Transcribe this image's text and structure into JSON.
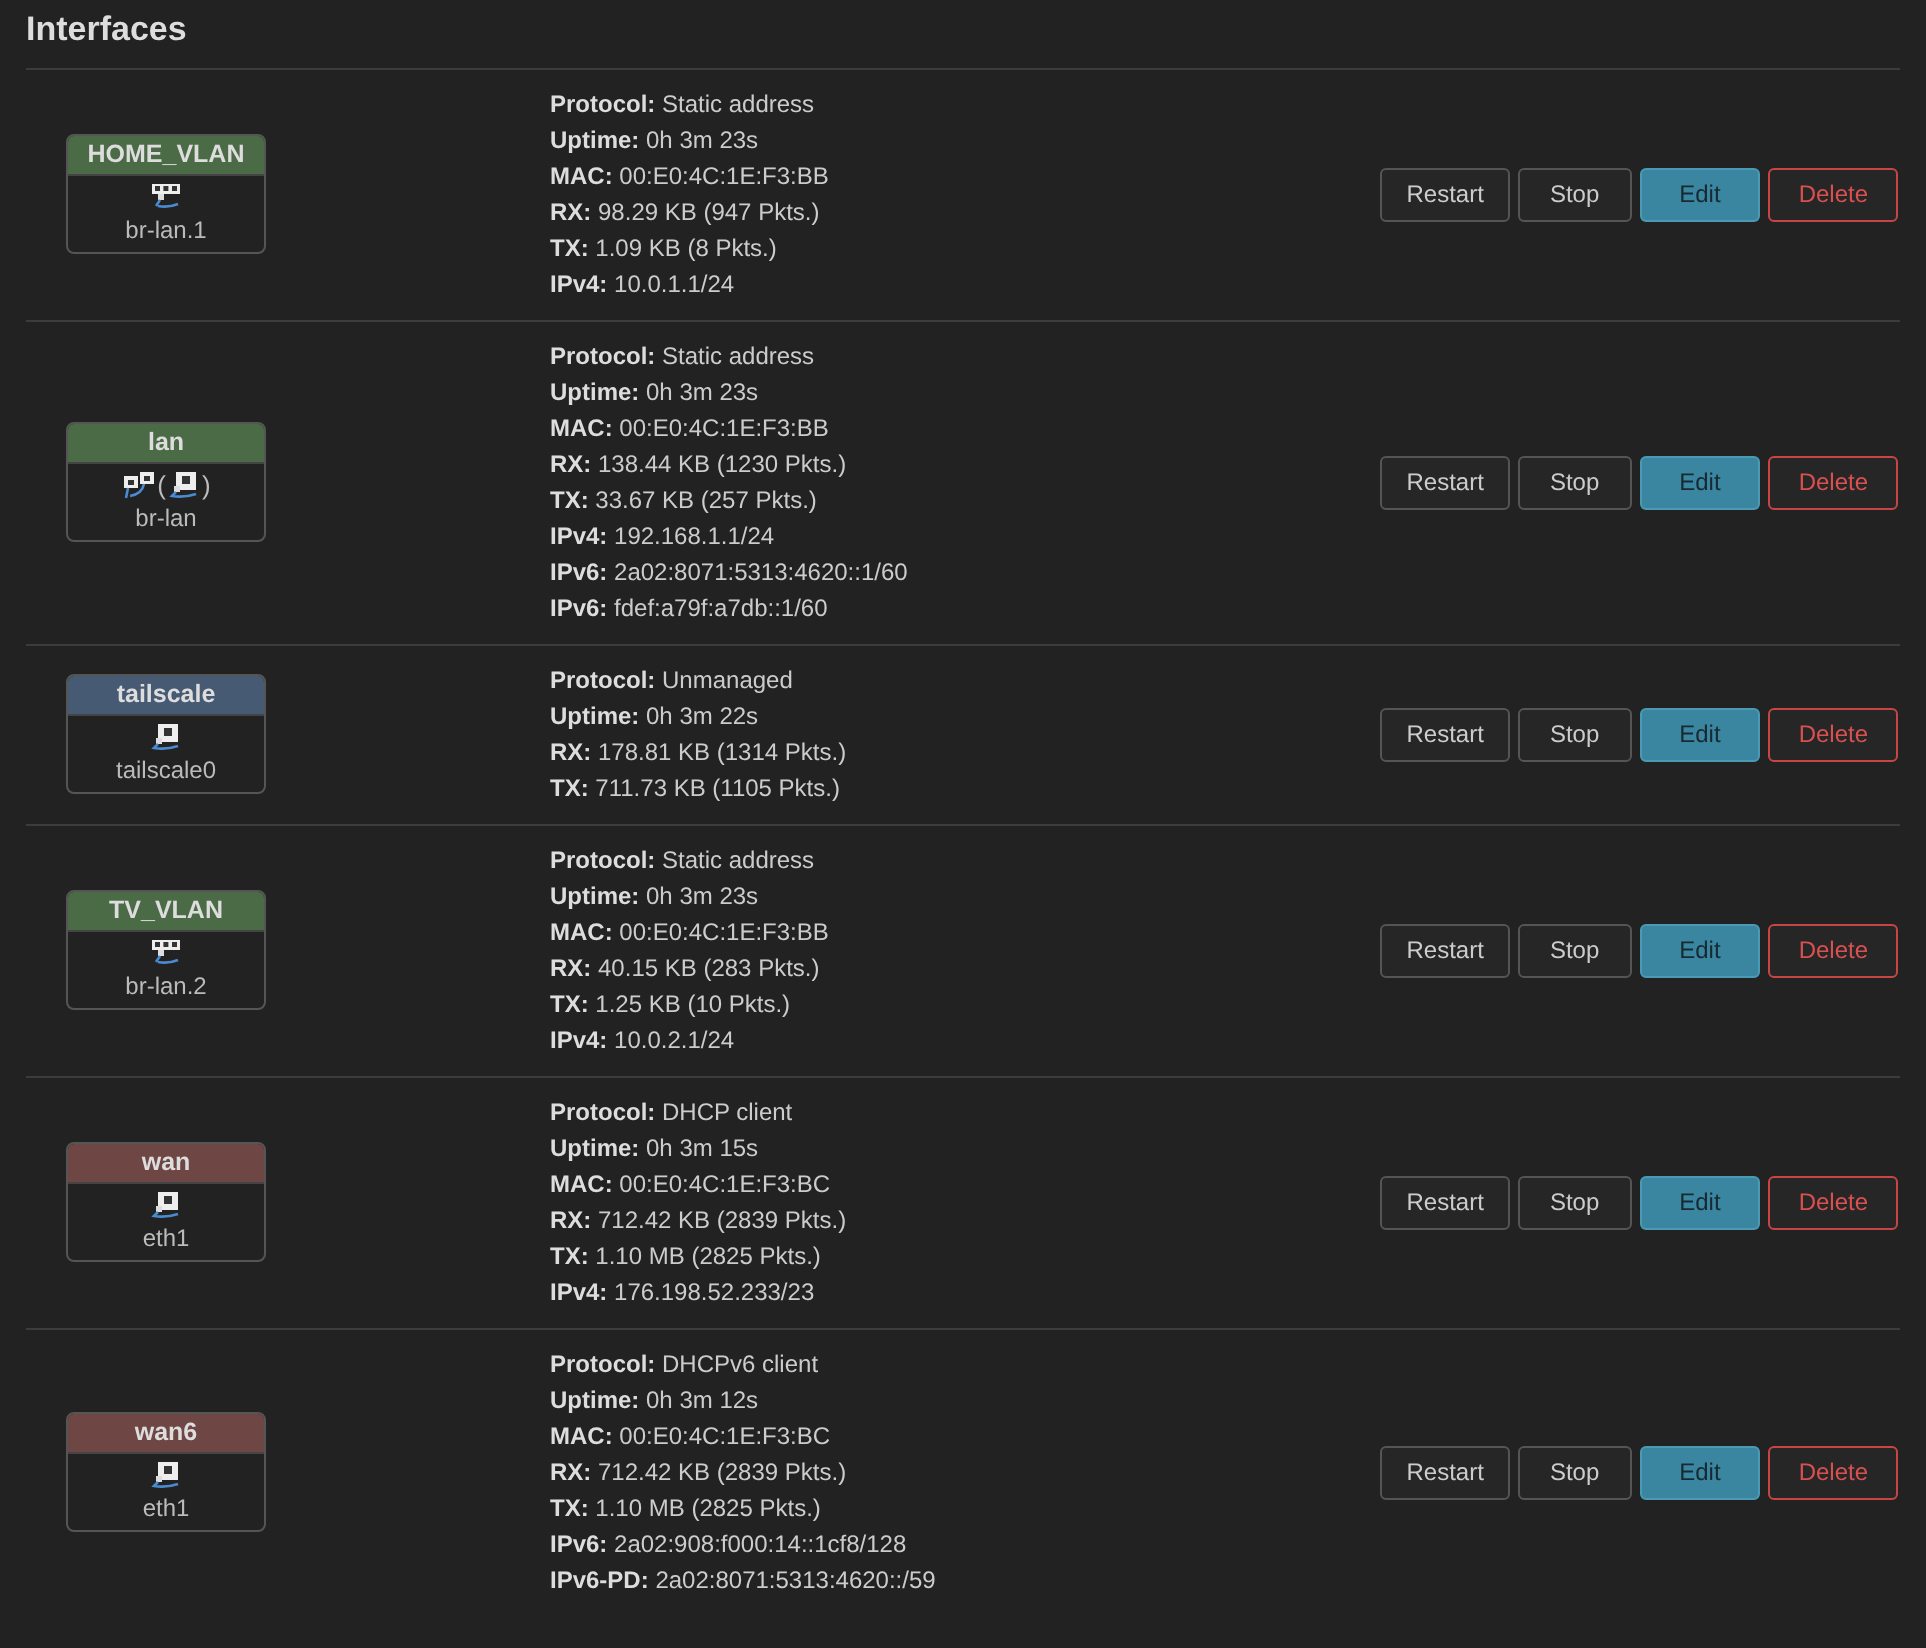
{
  "title": "Interfaces",
  "interfaces": [
    {
      "name": "HOME_VLAN",
      "color": "#4b6b47",
      "device_parts": [
        {
          "kind": "switch"
        }
      ],
      "device": "br-lan.1",
      "details": [
        {
          "label": "Protocol:",
          "value": "Static address"
        },
        {
          "label": "Uptime:",
          "value": "0h 3m 23s"
        },
        {
          "label": "MAC:",
          "value": "00:E0:4C:1E:F3:BB"
        },
        {
          "label": "RX:",
          "value": "98.29 KB (947 Pkts.)"
        },
        {
          "label": "TX:",
          "value": "1.09 KB (8 Pkts.)"
        },
        {
          "label": "IPv4:",
          "value": "10.0.1.1/24"
        }
      ],
      "buttons": [
        {
          "label": "Restart",
          "kind": "default"
        },
        {
          "label": "Stop",
          "kind": "default"
        },
        {
          "label": "Edit",
          "kind": "edit"
        },
        {
          "label": "Delete",
          "kind": "delete"
        }
      ]
    },
    {
      "name": "lan",
      "color": "#4b6b47",
      "device_parts": [
        {
          "kind": "bridge"
        },
        {
          "kind": "text",
          "text": "("
        },
        {
          "kind": "port"
        },
        {
          "kind": "text",
          "text": ")"
        }
      ],
      "device": "br-lan",
      "details": [
        {
          "label": "Protocol:",
          "value": "Static address"
        },
        {
          "label": "Uptime:",
          "value": "0h 3m 23s"
        },
        {
          "label": "MAC:",
          "value": "00:E0:4C:1E:F3:BB"
        },
        {
          "label": "RX:",
          "value": "138.44 KB (1230 Pkts.)"
        },
        {
          "label": "TX:",
          "value": "33.67 KB (257 Pkts.)"
        },
        {
          "label": "IPv4:",
          "value": "192.168.1.1/24"
        },
        {
          "label": "IPv6:",
          "value": "2a02:8071:5313:4620::1/60"
        },
        {
          "label": "IPv6:",
          "value": "fdef:a79f:a7db::1/60"
        }
      ],
      "buttons": [
        {
          "label": "Restart",
          "kind": "default"
        },
        {
          "label": "Stop",
          "kind": "default"
        },
        {
          "label": "Edit",
          "kind": "edit"
        },
        {
          "label": "Delete",
          "kind": "delete"
        }
      ]
    },
    {
      "name": "tailscale",
      "color": "#465a74",
      "device_parts": [
        {
          "kind": "port"
        }
      ],
      "device": "tailscale0",
      "details": [
        {
          "label": "Protocol:",
          "value": "Unmanaged"
        },
        {
          "label": "Uptime:",
          "value": "0h 3m 22s"
        },
        {
          "label": "RX:",
          "value": "178.81 KB (1314 Pkts.)"
        },
        {
          "label": "TX:",
          "value": "711.73 KB (1105 Pkts.)"
        }
      ],
      "buttons": [
        {
          "label": "Restart",
          "kind": "default"
        },
        {
          "label": "Stop",
          "kind": "default"
        },
        {
          "label": "Edit",
          "kind": "edit"
        },
        {
          "label": "Delete",
          "kind": "delete"
        }
      ]
    },
    {
      "name": "TV_VLAN",
      "color": "#4b6b47",
      "device_parts": [
        {
          "kind": "switch"
        }
      ],
      "device": "br-lan.2",
      "details": [
        {
          "label": "Protocol:",
          "value": "Static address"
        },
        {
          "label": "Uptime:",
          "value": "0h 3m 23s"
        },
        {
          "label": "MAC:",
          "value": "00:E0:4C:1E:F3:BB"
        },
        {
          "label": "RX:",
          "value": "40.15 KB (283 Pkts.)"
        },
        {
          "label": "TX:",
          "value": "1.25 KB (10 Pkts.)"
        },
        {
          "label": "IPv4:",
          "value": "10.0.2.1/24"
        }
      ],
      "buttons": [
        {
          "label": "Restart",
          "kind": "default"
        },
        {
          "label": "Stop",
          "kind": "default"
        },
        {
          "label": "Edit",
          "kind": "edit"
        },
        {
          "label": "Delete",
          "kind": "delete"
        }
      ]
    },
    {
      "name": "wan",
      "color": "#6e4644",
      "device_parts": [
        {
          "kind": "port"
        }
      ],
      "device": "eth1",
      "details": [
        {
          "label": "Protocol:",
          "value": "DHCP client"
        },
        {
          "label": "Uptime:",
          "value": "0h 3m 15s"
        },
        {
          "label": "MAC:",
          "value": "00:E0:4C:1E:F3:BC"
        },
        {
          "label": "RX:",
          "value": "712.42 KB (2839 Pkts.)"
        },
        {
          "label": "TX:",
          "value": "1.10 MB (2825 Pkts.)"
        },
        {
          "label": "IPv4:",
          "value": "176.198.52.233/23"
        }
      ],
      "buttons": [
        {
          "label": "Restart",
          "kind": "default"
        },
        {
          "label": "Stop",
          "kind": "default"
        },
        {
          "label": "Edit",
          "kind": "edit"
        },
        {
          "label": "Delete",
          "kind": "delete"
        }
      ]
    },
    {
      "name": "wan6",
      "color": "#6e4644",
      "device_parts": [
        {
          "kind": "port"
        }
      ],
      "device": "eth1",
      "details": [
        {
          "label": "Protocol:",
          "value": "DHCPv6 client"
        },
        {
          "label": "Uptime:",
          "value": "0h 3m 12s"
        },
        {
          "label": "MAC:",
          "value": "00:E0:4C:1E:F3:BC"
        },
        {
          "label": "RX:",
          "value": "712.42 KB (2839 Pkts.)"
        },
        {
          "label": "TX:",
          "value": "1.10 MB (2825 Pkts.)"
        },
        {
          "label": "IPv6:",
          "value": "2a02:908:f000:14::1cf8/128"
        },
        {
          "label": "IPv6-PD:",
          "value": "2a02:8071:5313:4620::/59"
        }
      ],
      "buttons": [
        {
          "label": "Restart",
          "kind": "default"
        },
        {
          "label": "Stop",
          "kind": "default"
        },
        {
          "label": "Edit",
          "kind": "edit"
        },
        {
          "label": "Delete",
          "kind": "delete"
        }
      ]
    }
  ]
}
